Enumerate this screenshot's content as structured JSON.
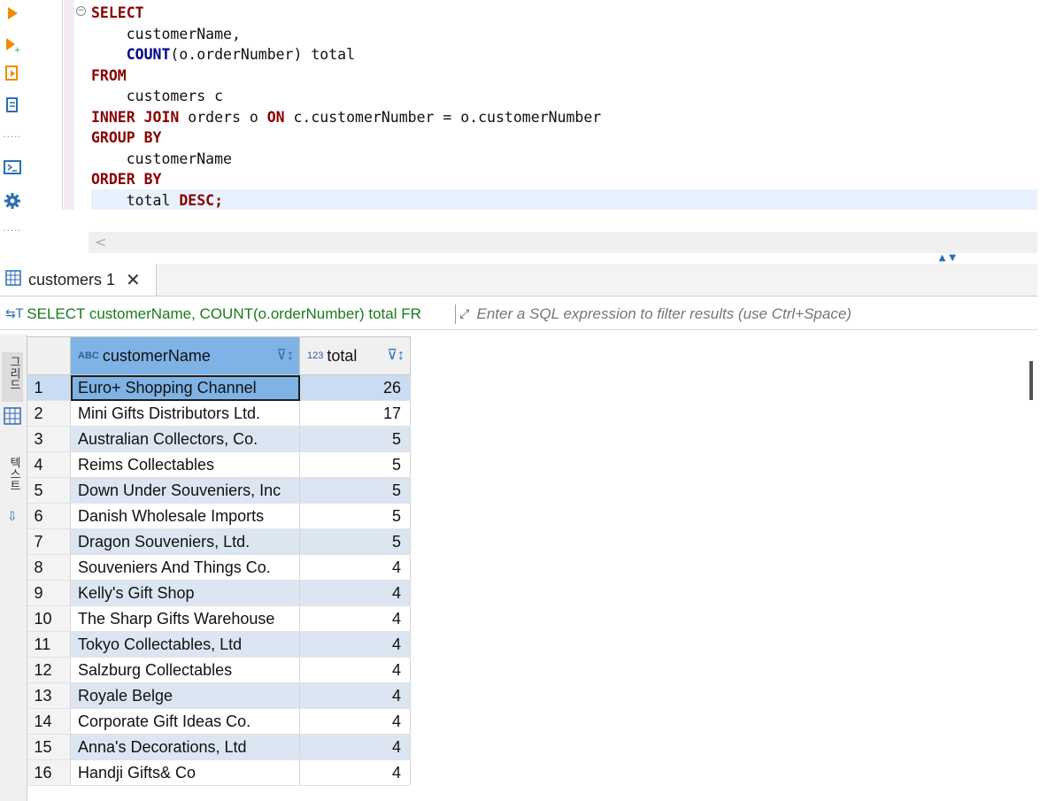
{
  "toolbar": {
    "icons": [
      "execute-statement-icon",
      "execute-in-new-tab-icon",
      "execute-script-icon",
      "explain-plan-icon",
      "terminal-icon",
      "settings-icon"
    ],
    "dots": "....."
  },
  "editor": {
    "lines": [
      {
        "parts": [
          {
            "t": "SELECT",
            "c": "kw"
          }
        ]
      },
      {
        "parts": [
          {
            "t": "    customerName,",
            "c": "tx"
          }
        ]
      },
      {
        "parts": [
          {
            "t": "    ",
            "c": "tx"
          },
          {
            "t": "COUNT",
            "c": "fn"
          },
          {
            "t": "(o.orderNumber) total",
            "c": "tx"
          }
        ]
      },
      {
        "parts": [
          {
            "t": "FROM",
            "c": "kw"
          }
        ]
      },
      {
        "parts": [
          {
            "t": "    customers c",
            "c": "tx"
          }
        ]
      },
      {
        "parts": [
          {
            "t": "INNER JOIN",
            "c": "kw"
          },
          {
            "t": " orders o ",
            "c": "tx"
          },
          {
            "t": "ON",
            "c": "kw"
          },
          {
            "t": " c.customerNumber = o.customerNumber",
            "c": "tx"
          }
        ]
      },
      {
        "parts": [
          {
            "t": "GROUP BY",
            "c": "kw"
          }
        ]
      },
      {
        "parts": [
          {
            "t": "    customerName",
            "c": "tx"
          }
        ]
      },
      {
        "parts": [
          {
            "t": "ORDER BY",
            "c": "kw"
          }
        ]
      },
      {
        "parts": [
          {
            "t": "    total ",
            "c": "tx"
          },
          {
            "t": "DESC;",
            "c": "kw"
          }
        ]
      }
    ],
    "hscroll_left": "<"
  },
  "results": {
    "tab_label": "customers 1",
    "tab_close": "✕",
    "filter_query": "SELECT customerName, COUNT(o.orderNumber) total FR",
    "filter_placeholder": "Enter a SQL expression to filter results (use Ctrl+Space)",
    "side_labels": [
      "그리드",
      "텍스트"
    ],
    "columns": [
      {
        "type_badge": "ABC",
        "label": "customerName"
      },
      {
        "type_badge": "123",
        "label": "total"
      }
    ],
    "rows": [
      {
        "n": "1",
        "name": "Euro+ Shopping Channel",
        "total": "26"
      },
      {
        "n": "2",
        "name": "Mini Gifts Distributors Ltd.",
        "total": "17"
      },
      {
        "n": "3",
        "name": "Australian Collectors, Co.",
        "total": "5"
      },
      {
        "n": "4",
        "name": "Reims Collectables",
        "total": "5"
      },
      {
        "n": "5",
        "name": "Down Under Souveniers, Inc",
        "total": "5"
      },
      {
        "n": "6",
        "name": "Danish Wholesale Imports",
        "total": "5"
      },
      {
        "n": "7",
        "name": "Dragon Souveniers, Ltd.",
        "total": "5"
      },
      {
        "n": "8",
        "name": "Souveniers And Things Co.",
        "total": "4"
      },
      {
        "n": "9",
        "name": "Kelly's Gift Shop",
        "total": "4"
      },
      {
        "n": "10",
        "name": "The Sharp Gifts Warehouse",
        "total": "4"
      },
      {
        "n": "11",
        "name": "Tokyo Collectables, Ltd",
        "total": "4"
      },
      {
        "n": "12",
        "name": "Salzburg Collectables",
        "total": "4"
      },
      {
        "n": "13",
        "name": "Royale Belge",
        "total": "4"
      },
      {
        "n": "14",
        "name": "Corporate Gift Ideas Co.",
        "total": "4"
      },
      {
        "n": "15",
        "name": "Anna's Decorations, Ltd",
        "total": "4"
      },
      {
        "n": "16",
        "name": "Handji Gifts& Co",
        "total": "4"
      }
    ],
    "selected_row": 0
  },
  "colors": {
    "keyword": "#8b0000",
    "function": "#00008b",
    "filter_query": "#1a7a1a",
    "selection": "#7fb3e6",
    "alt_row": "#dce6f2"
  }
}
